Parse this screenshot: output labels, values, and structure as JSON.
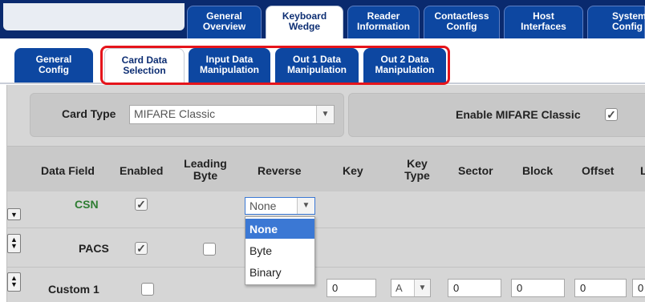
{
  "top_tabs": [
    {
      "label1": "General",
      "label2": "Overview"
    },
    {
      "label1": "Keyboard",
      "label2": "Wedge"
    },
    {
      "label1": "Reader",
      "label2": "Information"
    },
    {
      "label1": "Contactless",
      "label2": "Config"
    },
    {
      "label1": "Host",
      "label2": "Interfaces"
    },
    {
      "label1": "System",
      "label2": "Config"
    }
  ],
  "sub_tabs": [
    {
      "label1": "General",
      "label2": "Config"
    },
    {
      "label1": "Card Data",
      "label2": "Selection"
    },
    {
      "label1": "Input Data",
      "label2": "Manipulation"
    },
    {
      "label1": "Out 1 Data",
      "label2": "Manipulation"
    },
    {
      "label1": "Out 2 Data",
      "label2": "Manipulation"
    }
  ],
  "card_type": {
    "label": "Card Type",
    "value": "MIFARE Classic",
    "arrow": "▼"
  },
  "enable": {
    "label": "Enable MIFARE Classic",
    "checked": "✓"
  },
  "columns": {
    "data_field": "Data Field",
    "enabled": "Enabled",
    "leading_byte_1": "Leading",
    "leading_byte_2": "Byte",
    "reverse": "Reverse",
    "key": "Key",
    "key_type_1": "Key",
    "key_type_2": "Type",
    "sector": "Sector",
    "block": "Block",
    "offset": "Offset",
    "last": "L"
  },
  "rows": [
    {
      "label": "CSN",
      "enabled": "✓",
      "reverse": "None",
      "arrow": "▼"
    },
    {
      "label": "PACS",
      "enabled": "✓"
    },
    {
      "label": "Custom 1",
      "key": "0",
      "key_type": "A",
      "arrow": "▼",
      "sector": "0",
      "block": "0",
      "offset": "0",
      "last": "0"
    }
  ],
  "dropdown_options": [
    "None",
    "Byte",
    "Binary"
  ],
  "side_buttons": {
    "down": "▼",
    "up": "▲"
  },
  "colors": {
    "nav_bg": "#0a2a6e",
    "tab_blue": "#0d47a1",
    "highlight": "#e5141b",
    "csn_green": "#2e7d32",
    "selected_option": "#3b78d4"
  }
}
